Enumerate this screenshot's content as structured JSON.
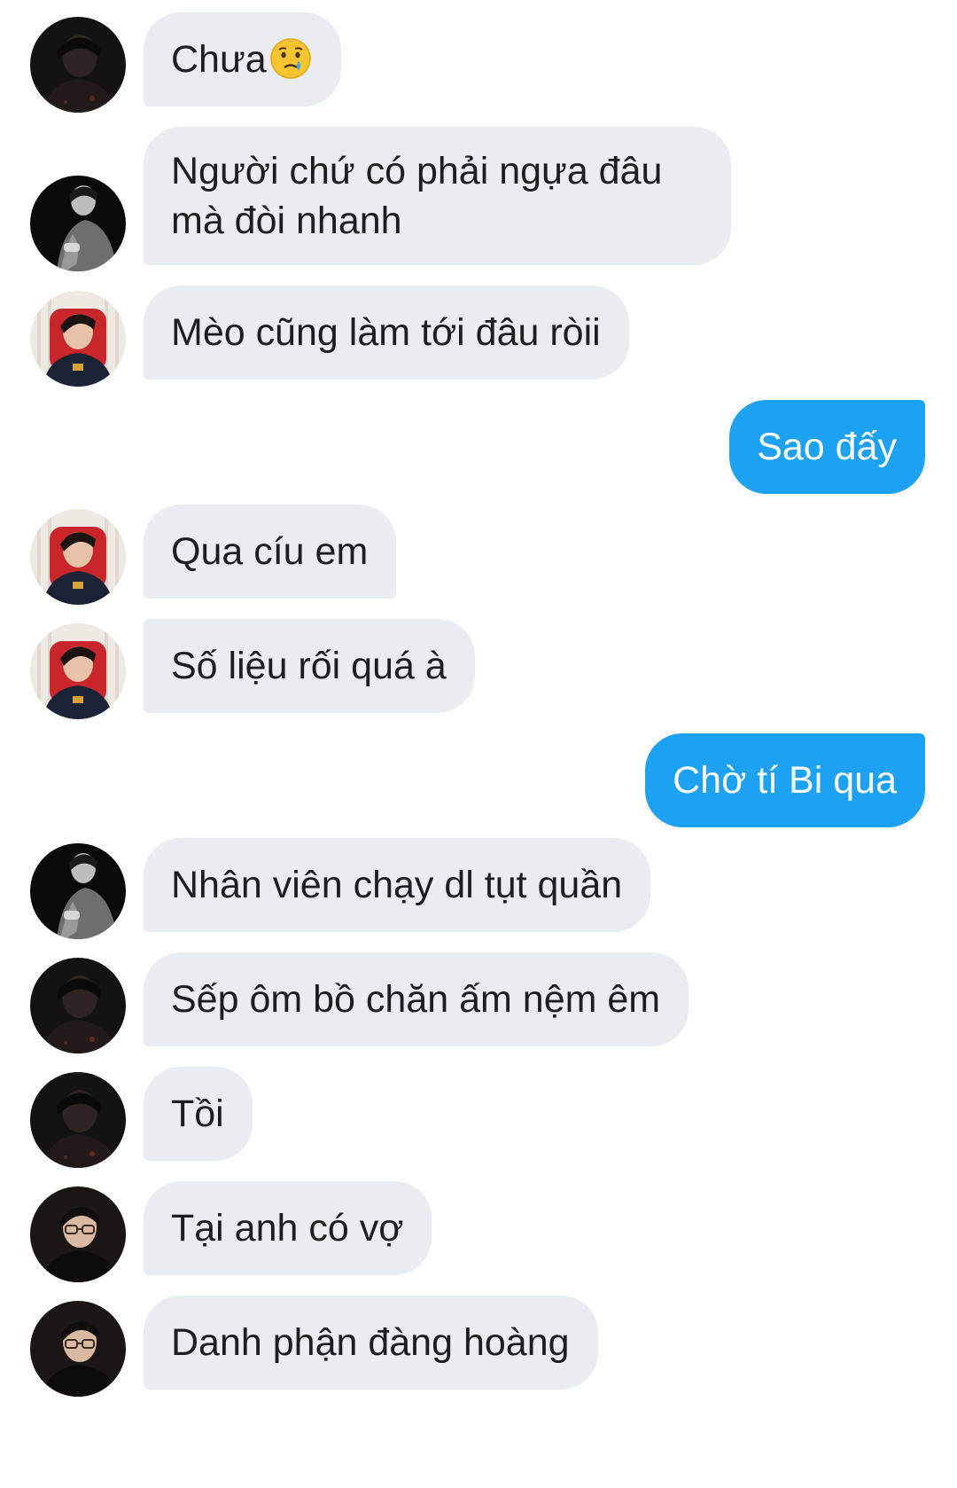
{
  "messages": [
    {
      "side": "in",
      "text": "Chưa",
      "emoji": "crying-face-emoji",
      "avatar": "avatar-dark-guy"
    },
    {
      "side": "in",
      "text": "Người chứ có phải ngựa đâu mà đòi nhanh",
      "avatar": "avatar-bw-guy"
    },
    {
      "side": "in",
      "text": "Mèo cũng làm tới đâu ròii",
      "avatar": "avatar-red-chair-guy"
    },
    {
      "side": "out",
      "text": "Sao đấy"
    },
    {
      "side": "in",
      "text": "Qua cíu em",
      "avatar": "avatar-red-chair-guy"
    },
    {
      "side": "in",
      "text": "Số liệu rối quá à",
      "avatar": "avatar-red-chair-guy"
    },
    {
      "side": "out",
      "text": "Chờ tí Bi qua"
    },
    {
      "side": "in",
      "text": "Nhân viên chạy dl tụt quần",
      "avatar": "avatar-bw-guy"
    },
    {
      "side": "in",
      "text": "Sếp ôm bồ chăn ấm nệm êm",
      "avatar": "avatar-dark-guy"
    },
    {
      "side": "in",
      "text": "Tồi",
      "avatar": "avatar-dark-guy"
    },
    {
      "side": "in",
      "text": "Tại anh có vợ",
      "avatar": "avatar-glasses-guy"
    },
    {
      "side": "in",
      "text": "Danh phận đàng hoàng",
      "avatar": "avatar-glasses-guy"
    }
  ],
  "colors": {
    "incoming_bubble": "#e9edf1",
    "outgoing_bubble": "#1da1f2",
    "incoming_text": "#1c1e21",
    "outgoing_text": "#ffffff"
  }
}
